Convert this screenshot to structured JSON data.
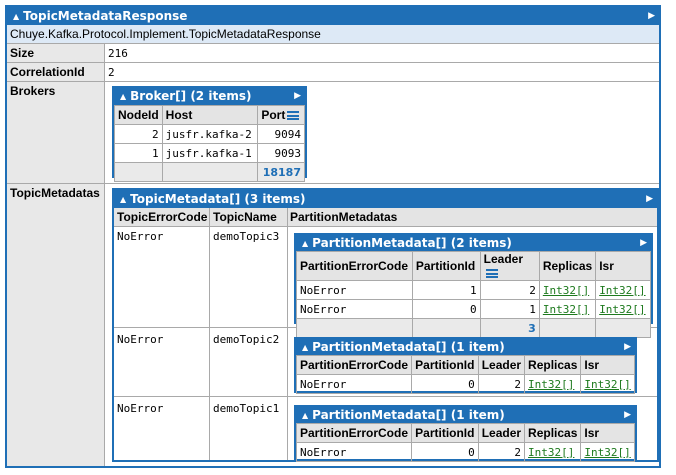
{
  "root": {
    "title": "TopicMetadataResponse",
    "type_name": "Chuye.Kafka.Protocol.Implement.TopicMetadataResponse",
    "fields": {
      "size_label": "Size",
      "size_value": "216",
      "corr_label": "CorrelationId",
      "corr_value": "2",
      "brokers_label": "Brokers",
      "topicmeta_label": "TopicMetadatas"
    }
  },
  "brokers": {
    "title": "Broker[] (2 items)",
    "columns": [
      "NodeId",
      "Host",
      "Port"
    ],
    "rows": [
      {
        "node": "2",
        "host": "jusfr.kafka-2",
        "port": "9094"
      },
      {
        "node": "1",
        "host": "jusfr.kafka-1",
        "port": "9093"
      }
    ],
    "sum": "18187"
  },
  "topics": {
    "title": "TopicMetadata[] (3 items)",
    "columns": [
      "TopicErrorCode",
      "TopicName",
      "PartitionMetadatas"
    ],
    "rows": [
      {
        "error": "NoError",
        "name": "demoTopic3",
        "pm_title": "PartitionMetadata[] (2 items)",
        "pm_rows": [
          {
            "err": "NoError",
            "pid": "1",
            "leader": "2",
            "replicas": "Int32[]",
            "isr": "Int32[]"
          },
          {
            "err": "NoError",
            "pid": "0",
            "leader": "1",
            "replicas": "Int32[]",
            "isr": "Int32[]"
          }
        ],
        "pm_sum": "3"
      },
      {
        "error": "NoError",
        "name": "demoTopic2",
        "pm_title": "PartitionMetadata[] (1 item)",
        "pm_rows": [
          {
            "err": "NoError",
            "pid": "0",
            "leader": "2",
            "replicas": "Int32[]",
            "isr": "Int32[]"
          }
        ]
      },
      {
        "error": "NoError",
        "name": "demoTopic1",
        "pm_title": "PartitionMetadata[] (1 item)",
        "pm_rows": [
          {
            "err": "NoError",
            "pid": "0",
            "leader": "2",
            "replicas": "Int32[]",
            "isr": "Int32[]"
          }
        ]
      }
    ],
    "pm_columns": [
      "PartitionErrorCode",
      "PartitionId",
      "Leader",
      "Replicas",
      "Isr"
    ]
  },
  "icons": {
    "collapse": "collapse-triangle-icon",
    "expand": "expand-arrow-icon",
    "menu": "column-menu-icon"
  },
  "colors": {
    "header": "#1f6fb6",
    "link": "#1e7a1e",
    "label_bg": "#e8e8e8"
  }
}
